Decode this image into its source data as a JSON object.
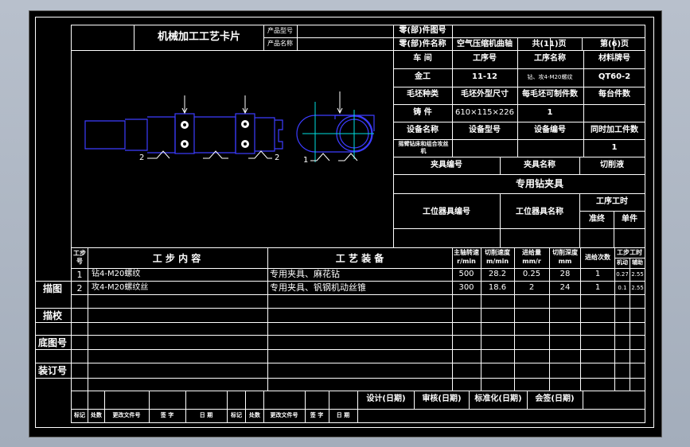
{
  "header": {
    "title": "机械加工工艺卡片",
    "product_model_label": "产品型号",
    "product_name_label": "产品名称",
    "part_drawing_no_label": "零(部)件图号",
    "part_name_label": "零(部)件名称",
    "part_name": "空气压缩机曲轴",
    "total_pages": "共(11)页",
    "page_no": "第(6)页"
  },
  "info": {
    "workshop_label": "车 间",
    "process_no_label": "工序号",
    "process_name_label": "工序名称",
    "material_label": "材料牌号",
    "workshop": "金工",
    "process_no": "11-12",
    "process_name": "钻、攻4-M20螺纹",
    "material": "QT60-2",
    "blank_type_label": "毛坯种类",
    "blank_size_label": "毛坯外型尺寸",
    "pieces_per_blank_label": "每毛坯可制件数",
    "pieces_per_unit_label": "每台件数",
    "blank_type": "铸 件",
    "blank_size": "610×115×226",
    "pieces_per_blank": "1",
    "equipment_name_label": "设备名称",
    "equipment_model_label": "设备型号",
    "equipment_no_label": "设备编号",
    "simultaneous_label": "同时加工件数",
    "equipment_name": "摇臂钻床和组合攻丝机",
    "simultaneous": "1",
    "fixture_no_label": "夹具编号",
    "fixture_name_label": "夹具名称",
    "coolant_label": "切削液",
    "fixture_name": "专用钻夹具",
    "station_tool_no_label": "工位器具编号",
    "station_tool_name_label": "工位器具名称",
    "process_time_label": "工序工时",
    "prep_label": "准终",
    "unit_label": "单件"
  },
  "sketch": {
    "labels": [
      "2",
      "2",
      "1"
    ]
  },
  "steps_header": {
    "step_no": "工步号",
    "content": "工 步 内 容",
    "equipment": "工 艺 装 备",
    "spindle_speed": "主轴转速",
    "spindle_unit": "r/min",
    "cutting_speed": "切削速度",
    "cutting_unit": "m/min",
    "feed": "进给量",
    "feed_unit": "mm/r",
    "depth": "切削深度",
    "depth_unit": "mm",
    "passes": "进给次数",
    "step_time": "工步工时",
    "machine_time": "机动",
    "aux_time": "辅助"
  },
  "steps": [
    {
      "no": "1",
      "content": "钻4-M20螺纹",
      "equipment": "专用夹具、麻花钻",
      "speed": "500",
      "cut": "28.2",
      "feed": "0.25",
      "depth": "28",
      "passes": "1",
      "machine": "0.27",
      "aux": "2.55"
    },
    {
      "no": "2",
      "content": "攻4-M20螺纹丝",
      "equipment": "专用夹具、钒钢机动丝锥",
      "speed": "300",
      "cut": "18.6",
      "feed": "2",
      "depth": "24",
      "passes": "1",
      "machine": "0.1",
      "aux": "2.55"
    }
  ],
  "side": {
    "trace": "描图",
    "check": "描校",
    "base_no": "底图号",
    "binding_no": "装订号"
  },
  "signoff": {
    "design": "设计(日期)",
    "review": "审核(日期)",
    "standard": "标准化(日期)",
    "sign": "会签(日期)"
  },
  "revision": {
    "mark": "标记",
    "count": "处数",
    "doc_no": "更改文件号",
    "signature": "签 字",
    "date": "日 期"
  }
}
